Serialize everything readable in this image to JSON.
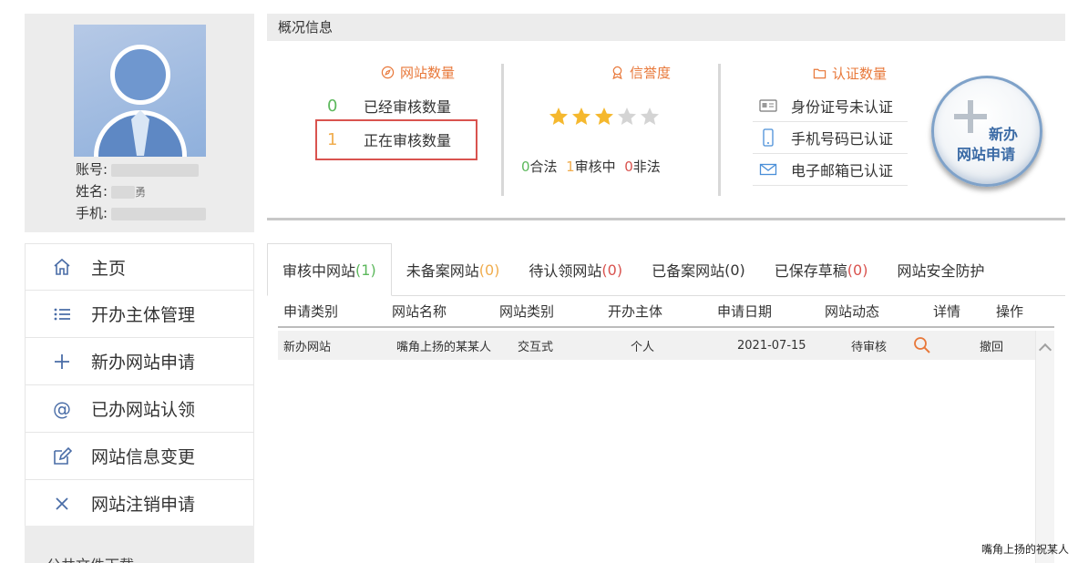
{
  "profile": {
    "account_label": "账号:",
    "name_label": "姓名:",
    "name_value_partial": "勇",
    "phone_label": "手机:"
  },
  "menu": {
    "items": [
      {
        "label": "主页",
        "icon": "home-icon"
      },
      {
        "label": "开办主体管理",
        "icon": "list-icon"
      },
      {
        "label": "新办网站申请",
        "icon": "plus-icon"
      },
      {
        "label": "已办网站认领",
        "icon": "at-icon"
      },
      {
        "label": "网站信息变更",
        "icon": "edit-icon"
      },
      {
        "label": "网站注销申请",
        "icon": "close-icon"
      }
    ],
    "footer_label": "公共文件下载"
  },
  "overview": {
    "header": "概况信息",
    "site_count": {
      "title": "网站数量",
      "rows": [
        {
          "count": "0",
          "label": "已经审核数量"
        },
        {
          "count": "1",
          "label": "正在审核数量"
        }
      ]
    },
    "credit": {
      "title": "信誉度",
      "stars_filled": 3,
      "stars_total": 5,
      "legal_count": "0",
      "legal_label": "合法",
      "reviewing_count": "1",
      "reviewing_label": "审核中",
      "illegal_count": "0",
      "illegal_label": "非法"
    },
    "auth": {
      "title": "认证数量",
      "rows": [
        {
          "label": "身份证号未认证",
          "icon": "id-card-icon"
        },
        {
          "label": "手机号码已认证",
          "icon": "phone-icon"
        },
        {
          "label": "电子邮箱已认证",
          "icon": "mail-icon"
        }
      ]
    },
    "new_button": {
      "line1": "新办",
      "line2": "网站申请"
    }
  },
  "tabs": [
    {
      "label": "审核中网站",
      "count": "(1)",
      "count_color": "#5cb85c",
      "active": true
    },
    {
      "label": "未备案网站",
      "count": "(0)",
      "count_color": "#f0ad4e",
      "active": false
    },
    {
      "label": "待认领网站",
      "count": "(0)",
      "count_color": "#d9534f",
      "active": false
    },
    {
      "label": "已备案网站",
      "count": "(0)",
      "count_color": "#333333",
      "active": false
    },
    {
      "label": "已保存草稿",
      "count": "(0)",
      "count_color": "#d9534f",
      "active": false
    },
    {
      "label": "网站安全防护",
      "count": "",
      "count_color": "#333333",
      "active": false
    }
  ],
  "table": {
    "headers": [
      "申请类别",
      "网站名称",
      "网站类别",
      "开办主体",
      "申请日期",
      "网站动态",
      "详情",
      "操作"
    ],
    "rows": [
      {
        "category": "新办网站",
        "site_name": "嘴角上扬的某某人",
        "site_type": "交互式",
        "owner": "个人",
        "date": "2021-07-15",
        "status": "待审核",
        "action": "撤回"
      }
    ]
  },
  "watermark": "嘴角上扬的祝某人"
}
